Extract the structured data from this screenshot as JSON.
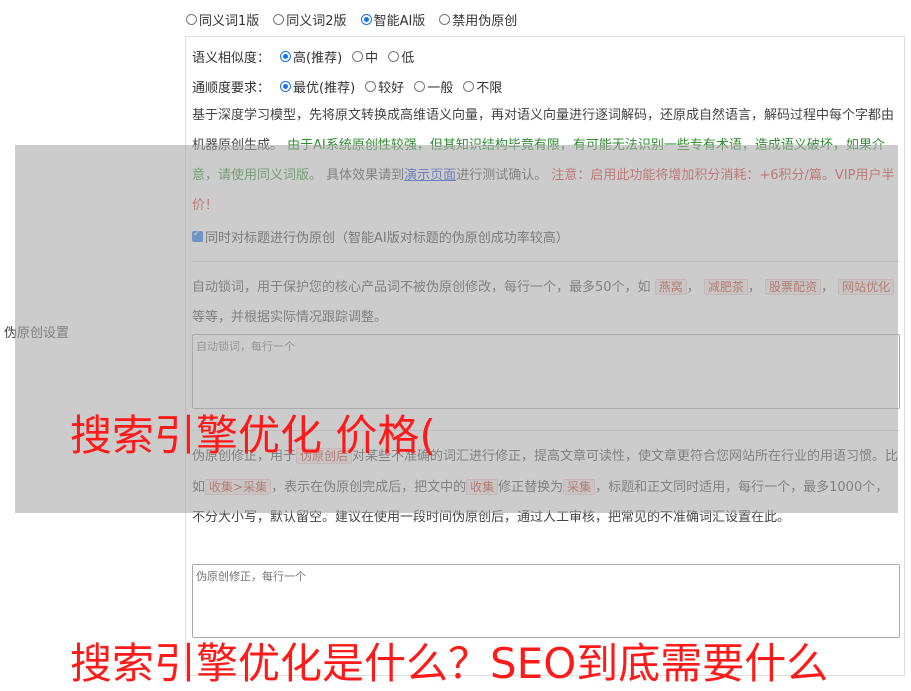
{
  "mode_options": [
    {
      "label": "同义词1版",
      "selected": false
    },
    {
      "label": "同义词2版",
      "selected": false
    },
    {
      "label": "智能AI版",
      "selected": true
    },
    {
      "label": "禁用伪原创",
      "selected": false
    }
  ],
  "side_label": "伪原创设置",
  "similarity": {
    "label": "语义相似度：",
    "options": [
      {
        "label": "高(推荐)",
        "selected": true
      },
      {
        "label": "中",
        "selected": false
      },
      {
        "label": "低",
        "selected": false
      }
    ]
  },
  "fluency": {
    "label": "通顺度要求：",
    "options": [
      {
        "label": "最优(推荐)",
        "selected": true
      },
      {
        "label": "较好",
        "selected": false
      },
      {
        "label": "一般",
        "selected": false
      },
      {
        "label": "不限",
        "selected": false
      }
    ]
  },
  "desc": {
    "p1": "基于深度学习模型，先将原文转换成高维语义向量，再对语义向量进行逐词解码，还原成自然语言，解码过程中每个字都由机器原创生成。",
    "p2": "由于AI系统原创性较强，但其知识结构毕竟有限，有可能无法识别一些专有术语，造成语义破坏，如果介意，请使用同义词版。",
    "p3": "具体效果请到",
    "link": "演示页面",
    "p4": "进行测试确认。",
    "p5": "注意：启用此功能将增加积分消耗：+6积分/篇。VIP用户半价！"
  },
  "title_checkbox": "同时对标题进行伪原创（智能AI版对标题的伪原创成功率较高）",
  "lock": {
    "text1": "自动锁词，用于保护您的核心产品词不被伪原创修改，每行一个，最多50个，如",
    "tags": [
      "燕窝",
      "减肥茶",
      "股票配资",
      "网站优化"
    ],
    "text2": "等等，并根据实际情况跟踪调整。",
    "placeholder": "自动锁词，每行一个"
  },
  "fix": {
    "text1": "伪原创修正，用于",
    "tag1": "伪原创后",
    "text2": "对某些不准确的词汇进行修正，提高文章可读性，使文章更符合您网站所在行业的用语习惯。比如",
    "tag2": "收集>采集",
    "text3": "，表示在伪原创完成后，把文中的",
    "tag3": "收集",
    "text4": "修正替换为",
    "tag4": "采集",
    "text5": "，标题和正文同时适用，每行一个，最多1000个，不分大小写，默认留空。建议在使用一段时间伪原创后，通过人工审核，把常见的不准确词汇设置在此。",
    "placeholder": "伪原创修正，每行一个"
  },
  "overlay_text1": "搜索引擎优化 价格(",
  "overlay_text2": "搜索引擎优化是什么？SEO到底需要什么"
}
